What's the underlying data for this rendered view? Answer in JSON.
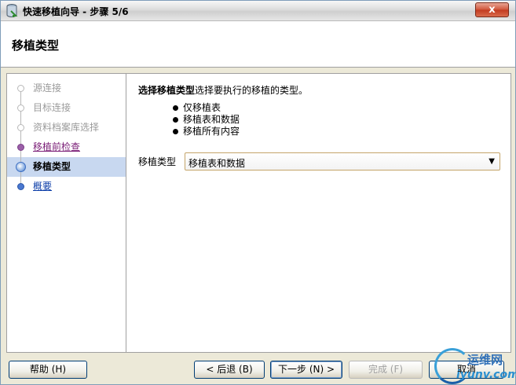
{
  "window": {
    "title": "快速移植向导 - 步骤 5/6",
    "close_label": "x"
  },
  "header": {
    "title": "移植类型"
  },
  "steps": [
    {
      "label": "源连接",
      "state": "done"
    },
    {
      "label": "目标连接",
      "state": "done"
    },
    {
      "label": "资料档案库选择",
      "state": "done"
    },
    {
      "label": "移植前检查",
      "state": "visited"
    },
    {
      "label": "移植类型",
      "state": "current"
    },
    {
      "label": "概要",
      "state": "pending"
    }
  ],
  "main": {
    "desc_bold": "选择移植类型",
    "desc_rest": "选择要执行的移植的类型。",
    "bullets": [
      "仅移植表",
      "移植表和数据",
      "移植所有内容"
    ],
    "type_label": "移植类型",
    "type_value": "移植表和数据"
  },
  "buttons": {
    "help": "帮助",
    "help_key": "(H)",
    "back": "< 后退",
    "back_key": "(B)",
    "next": "下一步",
    "next_key": "(N) >",
    "finish": "完成",
    "finish_key": "(F)",
    "cancel": "取消"
  },
  "watermark": {
    "cn": "运维网",
    "en": "iyunv.com"
  },
  "colors": {
    "accent": "#3d6fc2",
    "visited": "#7a1d76",
    "link": "#0b3da8",
    "close": "#c23a1f"
  }
}
